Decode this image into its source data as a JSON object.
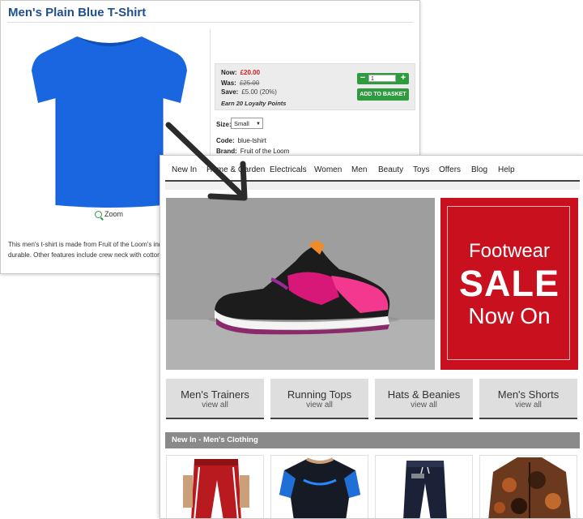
{
  "product_page": {
    "title": "Men's Plain Blue T-Shirt",
    "zoom_label": "Zoom",
    "price": {
      "now_label": "Now:",
      "now_value": "£20.00",
      "was_label": "Was:",
      "was_value": "£25.00",
      "save_label": "Save:",
      "save_value": "£5.00 (20%)",
      "loyalty": "Earn 20 Loyalty Points"
    },
    "quantity": {
      "minus": "−",
      "value": "1",
      "plus": "+"
    },
    "add_to_basket": "ADD TO BASKET",
    "size": {
      "label": "Size:",
      "selected": "Small"
    },
    "code": {
      "label": "Code:",
      "value": "blue-tshirt"
    },
    "brand": {
      "label": "Brand:",
      "value": "Fruit of the Loom"
    },
    "description_line1": "This men's t-shirt is made from Fruit of the Loom's innov",
    "description_line2": "durable. Other features include crew neck with cotton/Lyc"
  },
  "store_page": {
    "nav": [
      "New In",
      "Home & Garden",
      "Electricals",
      "Women",
      "Men",
      "Beauty",
      "Toys",
      "Offers",
      "Blog",
      "Help"
    ],
    "sale_banner": {
      "line1": "Footwear",
      "line2": "SALE",
      "line3": "Now On"
    },
    "categories": [
      {
        "name": "Men's Trainers",
        "sub": "view all"
      },
      {
        "name": "Running Tops",
        "sub": "view all"
      },
      {
        "name": "Hats & Beanies",
        "sub": "view all"
      },
      {
        "name": "Men's Shorts",
        "sub": "view all"
      }
    ],
    "section_title": "New In - Men's Clothing"
  },
  "colors": {
    "sale_red": "#c8101e",
    "add_green": "#2e9b3e",
    "title_blue": "#1f4f8f",
    "tshirt_blue": "#1a66e0"
  }
}
